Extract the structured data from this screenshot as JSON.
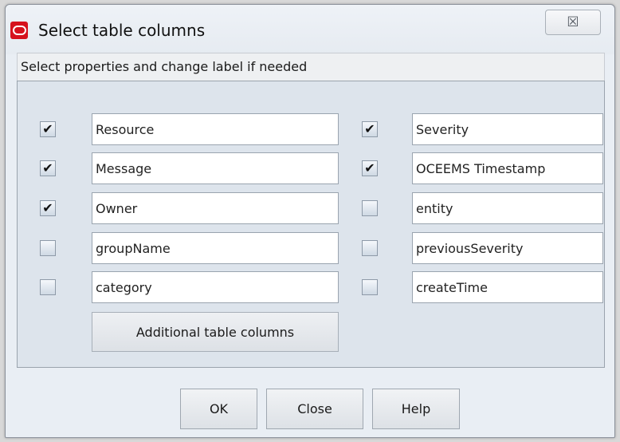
{
  "dialog": {
    "title": "Select table columns",
    "close_symbol": "☒",
    "instructions": "Select properties and change label if needed",
    "check_mark": "✔"
  },
  "columns": {
    "left": [
      {
        "checked": true,
        "label": "Resource"
      },
      {
        "checked": true,
        "label": "Message"
      },
      {
        "checked": true,
        "label": "Owner"
      },
      {
        "checked": false,
        "label": "groupName"
      },
      {
        "checked": false,
        "label": "category"
      }
    ],
    "right": [
      {
        "checked": true,
        "label": "Severity"
      },
      {
        "checked": true,
        "label": "OCEEMS Timestamp"
      },
      {
        "checked": false,
        "label": "entity"
      },
      {
        "checked": false,
        "label": "previousSeverity"
      },
      {
        "checked": false,
        "label": "createTime"
      }
    ]
  },
  "buttons": {
    "additional": "Additional table columns",
    "ok": "OK",
    "close": "Close",
    "help": "Help"
  },
  "icons": {
    "app": "oracle-logo-icon",
    "close": "close-icon"
  },
  "colors": {
    "app_icon": "#d6121d",
    "panel": "#dde4ec",
    "window": "#e9eef4"
  }
}
